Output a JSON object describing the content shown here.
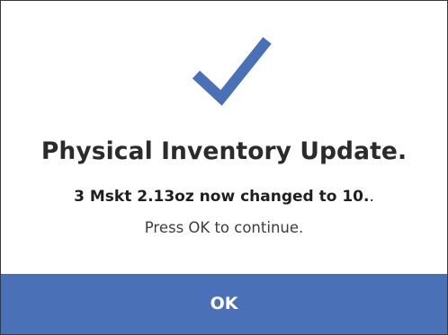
{
  "dialog": {
    "icon": "checkmark-icon",
    "title": "Physical Inventory Update.",
    "detail_bold": "3 Mskt 2.13oz now changed to 10.",
    "detail_trailing": ".",
    "subtext": "Press OK to continue.",
    "ok_label": "OK"
  },
  "colors": {
    "accent": "#4a70b8",
    "title_text": "#2b2b2b",
    "body_text": "#3d3d3d",
    "button_text": "#ffffff"
  }
}
